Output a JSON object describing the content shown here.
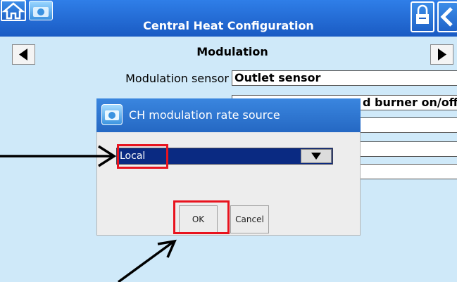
{
  "header": {
    "title": "Central Heat Configuration"
  },
  "section": {
    "title": "Modulation"
  },
  "form": {
    "rows": [
      {
        "label": "Modulation sensor",
        "value": "Outlet sensor"
      },
      {
        "label": "",
        "value": "d burner on/off"
      },
      {
        "label": "",
        "value": ""
      },
      {
        "label": "",
        "value": ""
      },
      {
        "label": "",
        "value": ""
      }
    ]
  },
  "dialog": {
    "title": "CH modulation rate source",
    "select_value": "Local",
    "ok_label": "OK",
    "cancel_label": "Cancel"
  },
  "colors": {
    "highlight": "#e8131e",
    "titlebar": "#1a5fc8",
    "background": "#cfe9f9"
  }
}
